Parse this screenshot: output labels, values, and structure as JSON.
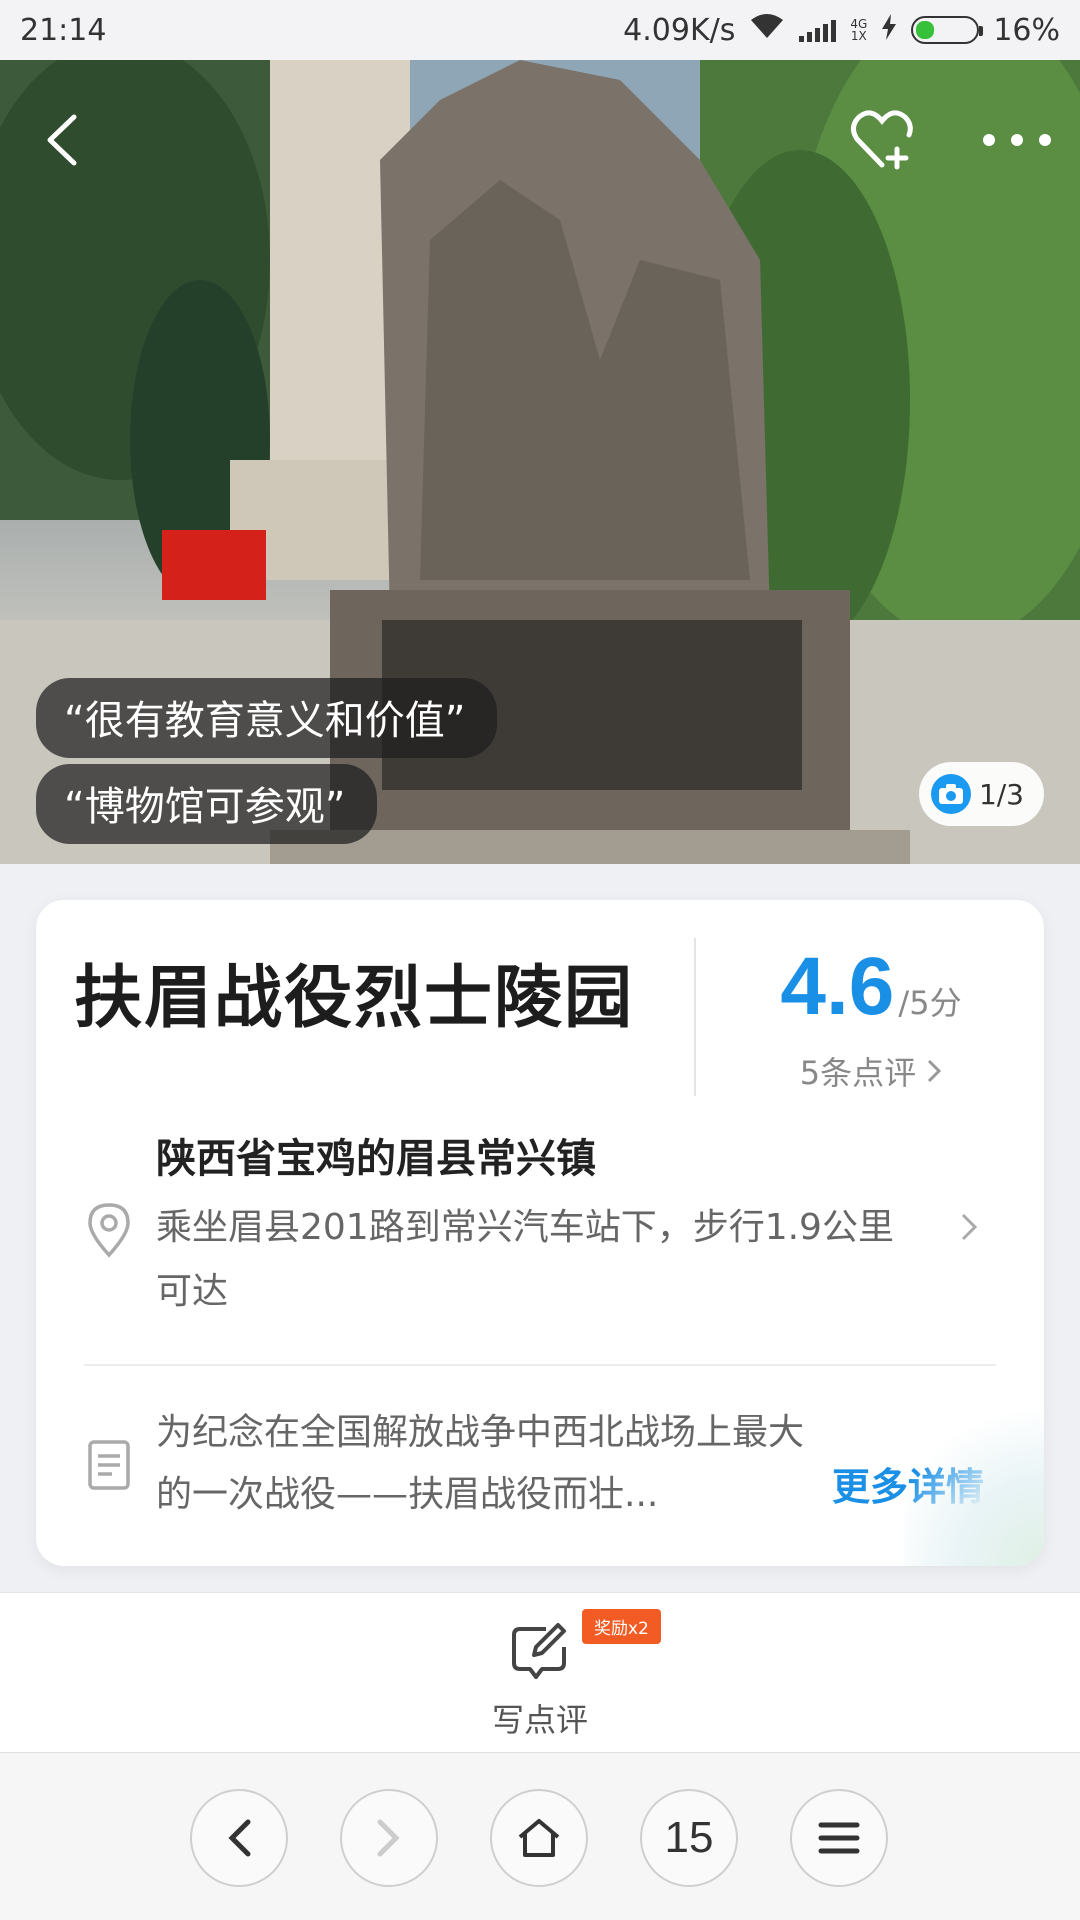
{
  "status_bar": {
    "time": "21:14",
    "net_speed": "4.09K/s",
    "net_type_top": "4G",
    "net_type_bottom": "1X",
    "battery": "16%"
  },
  "hero": {
    "quotes": [
      "“很有教育意义和价值”",
      "“博物馆可参观”"
    ],
    "photo_counter": "1/3"
  },
  "card": {
    "title": "扶眉战役烈士陵园",
    "rating": "4.6",
    "rating_max": "/5分",
    "review_count": "5条点评",
    "address_title": "陕西省宝鸡的眉县常兴镇",
    "address_route": "乘坐眉县201路到常兴汽车站下，步行1.9公里可达",
    "description": "为纪念在全国解放战争中西北战场上最大的一次战役——扶眉战役而壮...",
    "more_link": "更多详情"
  },
  "review_bar": {
    "reward_badge": "奖励x2",
    "write_label": "写点评"
  },
  "browser_nav": {
    "tab_count": "15"
  },
  "colors": {
    "accent": "#1a8fe6",
    "reward": "#f25c24"
  }
}
